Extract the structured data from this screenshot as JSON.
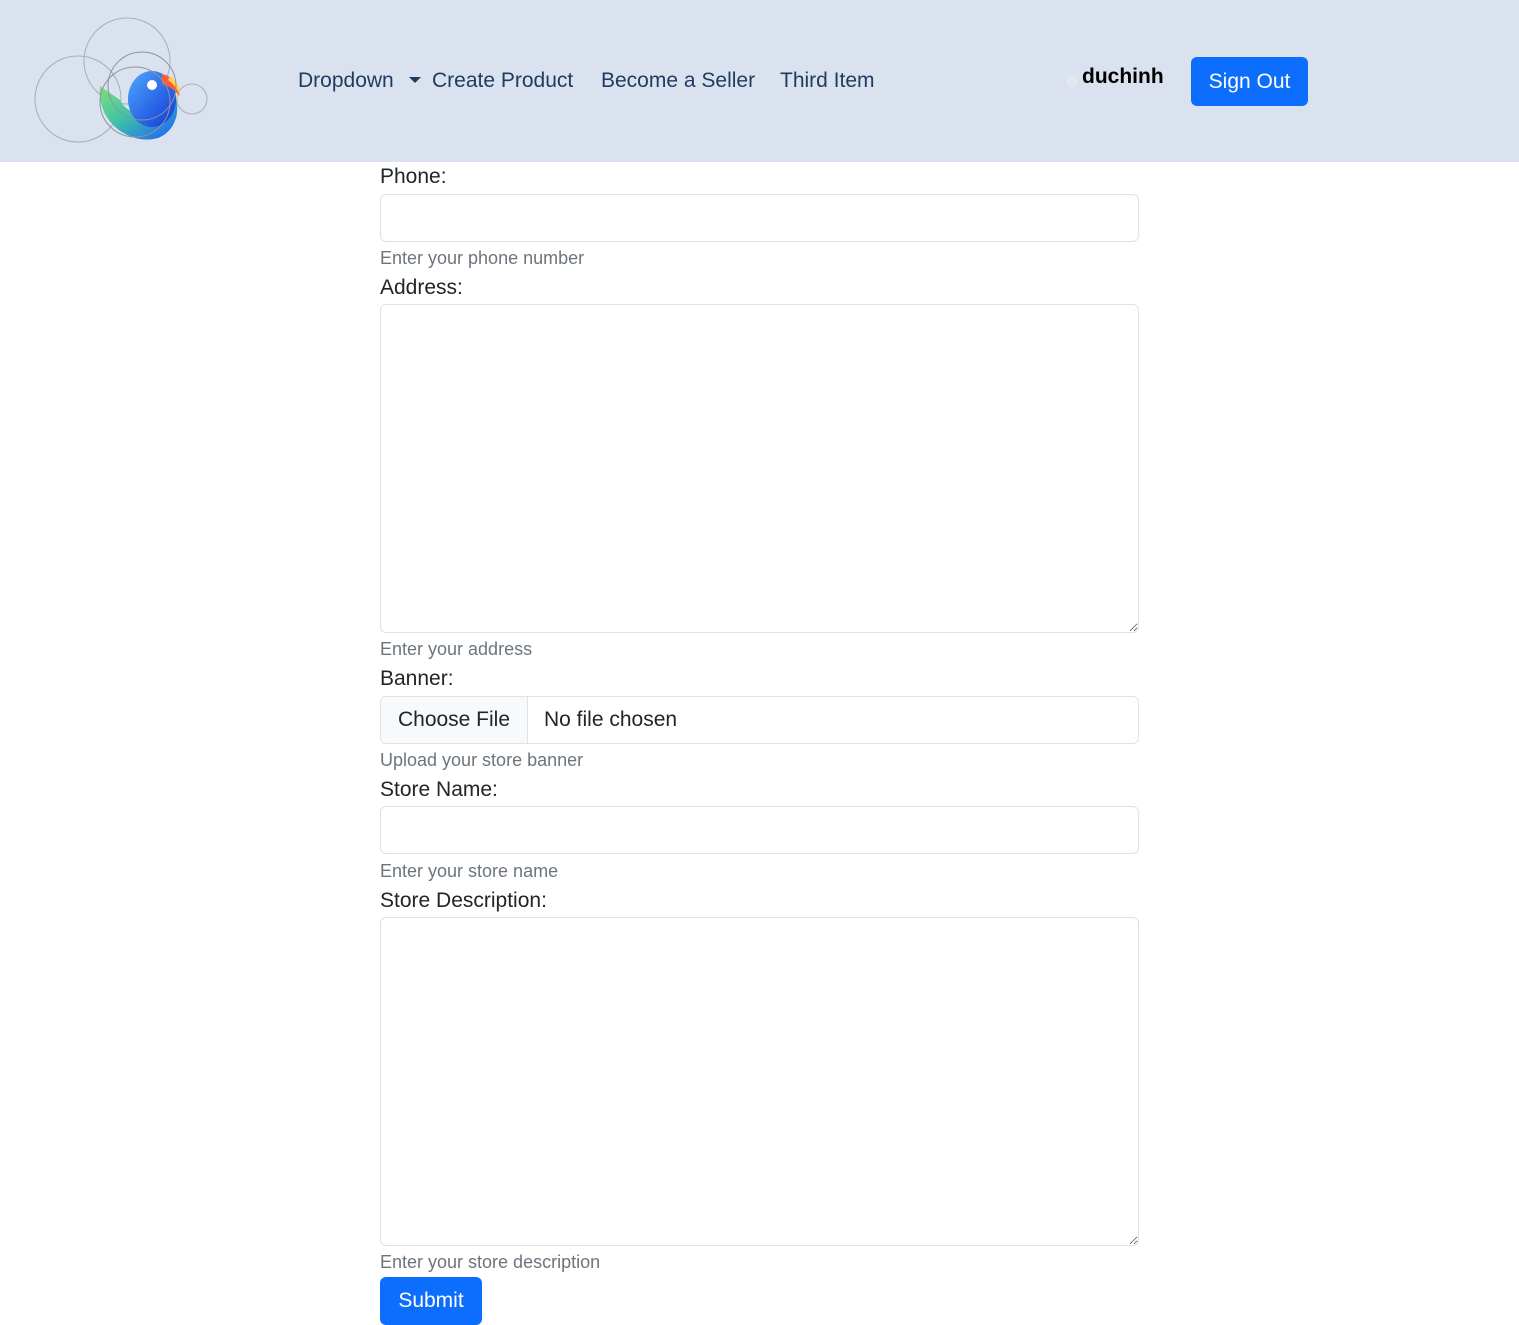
{
  "navbar": {
    "logo_icon": "colorful-bird-logo",
    "items": [
      {
        "label": "Dropdown"
      },
      {
        "label": "Create Product"
      },
      {
        "label": "Become a Seller"
      },
      {
        "label": "Third Item"
      }
    ],
    "username": "duchinh",
    "sign_out_label": "Sign Out",
    "background_color": "#dae2ef",
    "accent_color": "#0d6efd"
  },
  "form": {
    "phone": {
      "label": "Phone:",
      "value": "",
      "help": "Enter your phone number"
    },
    "address": {
      "label": "Address:",
      "value": "",
      "help": "Enter your address"
    },
    "banner": {
      "label": "Banner:",
      "button_label": "Choose File",
      "status": "No file chosen",
      "help": "Upload your store banner"
    },
    "store_name": {
      "label": "Store Name:",
      "value": "",
      "help": "Enter your store name"
    },
    "store_description": {
      "label": "Store Description:",
      "value": "",
      "help": "Enter your store description"
    },
    "submit_label": "Submit"
  }
}
